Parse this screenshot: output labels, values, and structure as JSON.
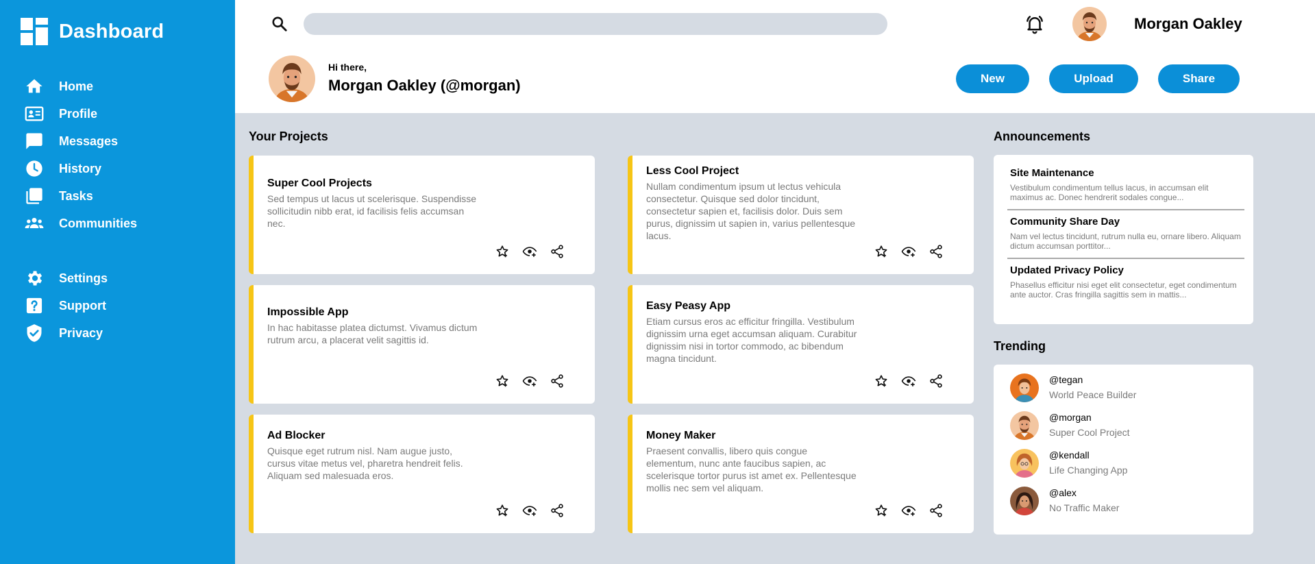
{
  "sidebar": {
    "title": "Dashboard",
    "nav": [
      {
        "label": "Home",
        "icon": "home-icon"
      },
      {
        "label": "Profile",
        "icon": "profile-card-icon"
      },
      {
        "label": "Messages",
        "icon": "message-icon"
      },
      {
        "label": "History",
        "icon": "clock-icon"
      },
      {
        "label": "Tasks",
        "icon": "documents-icon"
      },
      {
        "label": "Communities",
        "icon": "people-icon"
      }
    ],
    "nav_secondary": [
      {
        "label": "Settings",
        "icon": "gear-icon"
      },
      {
        "label": "Support",
        "icon": "help-icon"
      },
      {
        "label": "Privacy",
        "icon": "shield-icon"
      }
    ]
  },
  "header": {
    "search_placeholder": "",
    "username": "Morgan Oakley"
  },
  "profile": {
    "greeting": "Hi there,",
    "name": "Morgan Oakley (@morgan)"
  },
  "actions": {
    "new": "New",
    "upload": "Upload",
    "share": "Share"
  },
  "projects": {
    "title": "Your Projects",
    "items": [
      {
        "title": "Super Cool Projects",
        "desc": "Sed tempus ut lacus ut scelerisque. Suspendisse sollicitudin nibb erat, id facilisis felis accumsan nec."
      },
      {
        "title": "Less Cool Project",
        "desc": "Nullam condimentum ipsum ut lectus vehicula consectetur. Quisque sed dolor tincidunt, consectetur sapien et, facilisis dolor. Duis sem purus, dignissim ut sapien in, varius pellentesque lacus."
      },
      {
        "title": "Impossible App",
        "desc": "In hac habitasse platea dictumst. Vivamus dictum rutrum arcu, a placerat velit sagittis id."
      },
      {
        "title": "Easy Peasy App",
        "desc": "Etiam cursus eros ac efficitur fringilla. Vestibulum dignissim urna eget accumsan aliquam. Curabitur dignissim nisi in tortor commodo, ac bibendum magna tincidunt."
      },
      {
        "title": "Ad Blocker",
        "desc": "Quisque eget rutrum nisl. Nam augue justo, cursus vitae metus vel, pharetra hendreit felis. Aliquam sed malesuada eros."
      },
      {
        "title": "Money Maker",
        "desc": "Praesent convallis, libero quis congue elementum, nunc ante faucibus sapien, ac scelerisque tortor purus ist amet ex. Pellentesque mollis nec sem vel aliquam."
      }
    ]
  },
  "announcements": {
    "title": "Announcements",
    "items": [
      {
        "title": "Site Maintenance",
        "text": "Vestibulum condimentum tellus lacus, in accumsan elit maximus ac. Donec hendrerit sodales congue..."
      },
      {
        "title": "Community Share Day",
        "text": "Nam vel lectus tincidunt, rutrum nulla eu, ornare libero. Aliquam dictum accumsan porttitor..."
      },
      {
        "title": "Updated Privacy Policy",
        "text": "Phasellus efficitur nisi eget elit consectetur, eget condimentum ante auctor. Cras fringilla sagittis sem in mattis..."
      }
    ]
  },
  "trending": {
    "title": "Trending",
    "items": [
      {
        "handle": "@tegan",
        "project": "World Peace Builder"
      },
      {
        "handle": "@morgan",
        "project": "Super Cool Project"
      },
      {
        "handle": "@kendall",
        "project": "Life Changing App"
      },
      {
        "handle": "@alex",
        "project": "No Traffic Maker"
      }
    ]
  },
  "colors": {
    "sidebar": "#0b96dc",
    "button": "#0b8fd8",
    "accent": "#f6c516",
    "background": "#d5dbe3"
  }
}
